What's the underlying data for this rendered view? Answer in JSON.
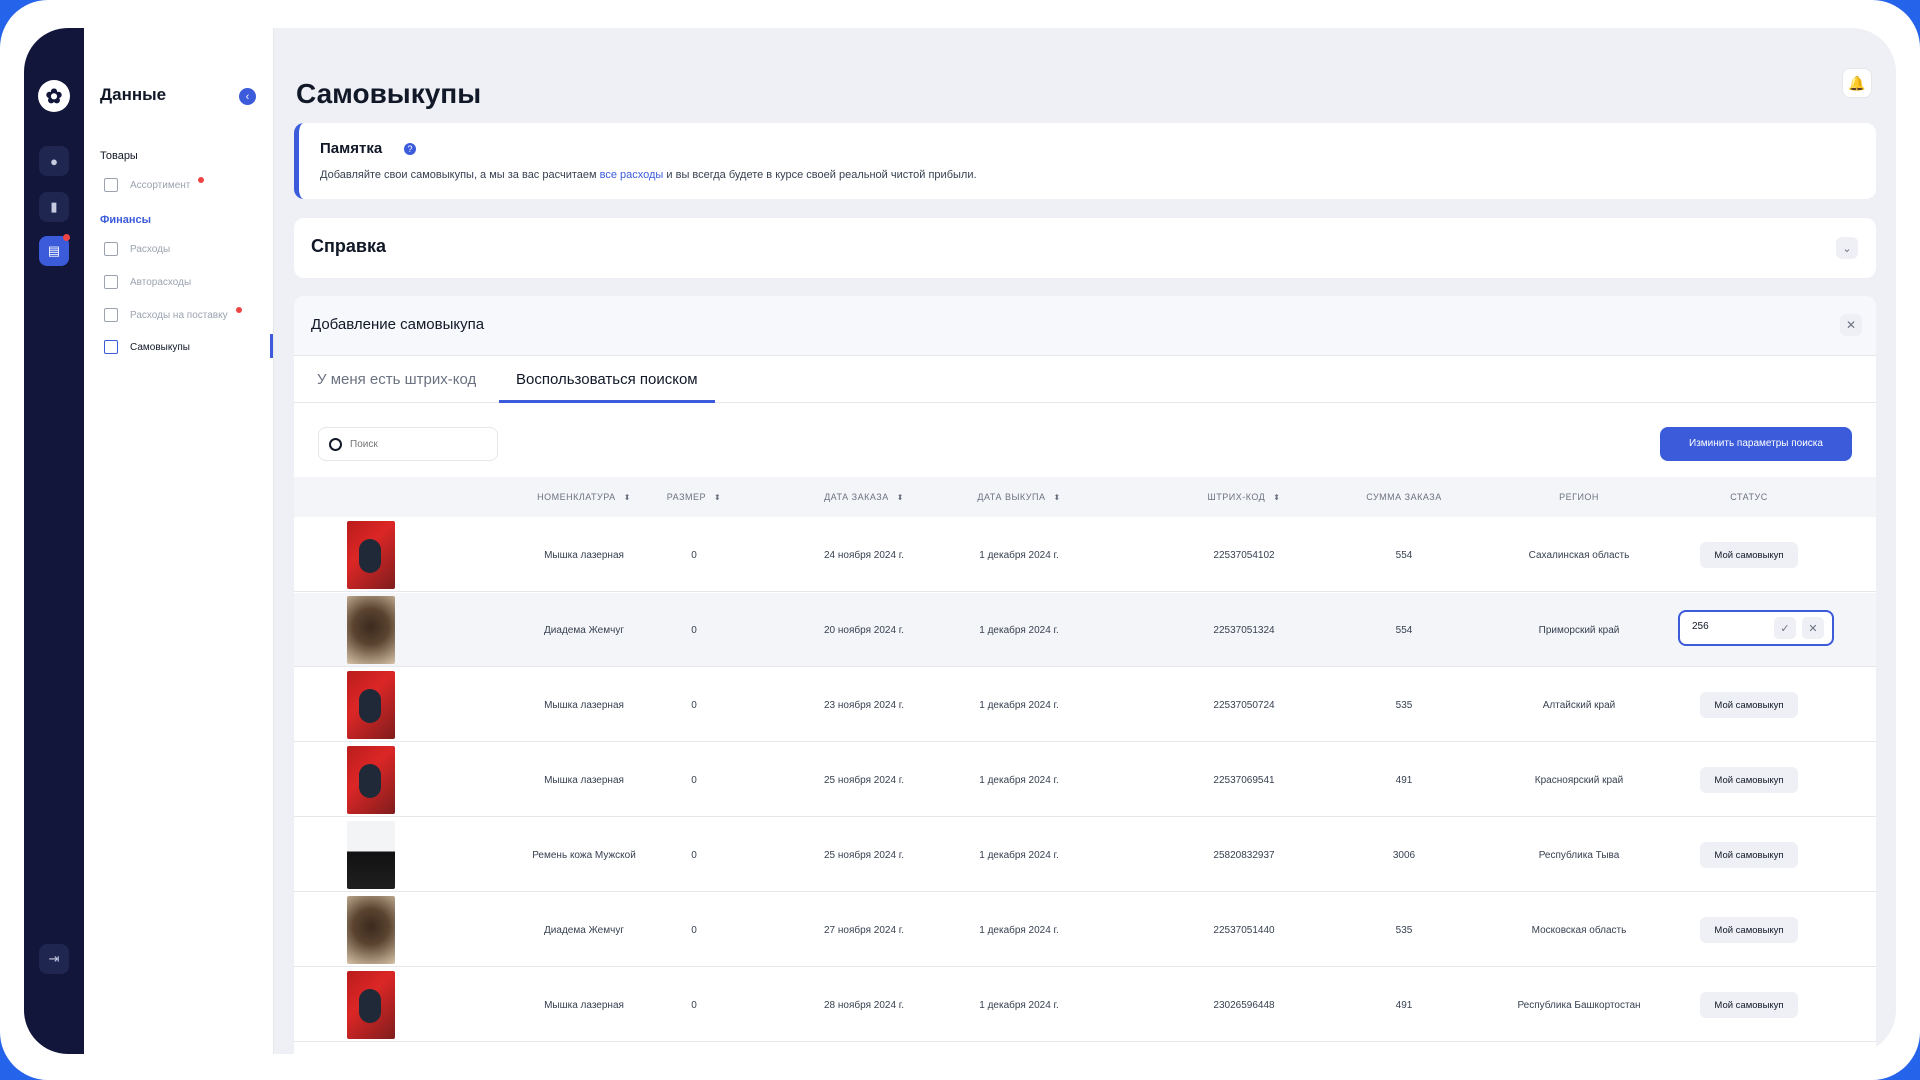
{
  "sidebar": {
    "title": "Данные",
    "groups": [
      {
        "label": "Товары",
        "items": [
          {
            "label": "Ассортимент"
          }
        ]
      },
      {
        "label": "Финансы",
        "items": [
          {
            "label": "Расходы"
          },
          {
            "label": "Авторасходы"
          },
          {
            "label": "Расходы на поставку"
          },
          {
            "label": "Самовыкупы"
          }
        ]
      }
    ]
  },
  "page": {
    "title": "Самовыкупы"
  },
  "memo": {
    "title": "Памятка",
    "text_before": "Добавляйте свои самовыкупы, а мы за вас расчитаем ",
    "link": "все расходы",
    "text_after": " и вы всегда будете в курсе своей реальной чистой прибыли."
  },
  "help": {
    "title": "Справка"
  },
  "panel": {
    "title": "Добавление самовыкупа",
    "tabs": [
      "У меня есть штрих-код",
      "Воспользоваться поиском"
    ],
    "search_placeholder": "Поиск",
    "primary_button": "Изминить параметры поиска"
  },
  "table": {
    "headers": [
      "НОМЕНКЛАТУРА",
      "РАЗМЕР",
      "ДАТА ЗАКАЗА",
      "ДАТА ВЫКУПА",
      "ШТРИХ-КОД",
      "СУММА ЗАКАЗА",
      "РЕГИОН",
      "СТАТУС"
    ],
    "status_label": "Мой самовыкуп",
    "edit_value": "256",
    "rows": [
      {
        "name": "Мышка лазерная",
        "size": "0",
        "order_date": "24 ноября 2024 г.",
        "buy_date": "1 декабря 2024 г.",
        "barcode": "22537054102",
        "sum": "554",
        "region": "Сахалинская область"
      },
      {
        "name": "Диадема Жемчуг",
        "size": "0",
        "order_date": "20 ноября 2024 г.",
        "buy_date": "1 декабря 2024 г.",
        "barcode": "22537051324",
        "sum": "554",
        "region": "Приморский край"
      },
      {
        "name": "Мышка лазерная",
        "size": "0",
        "order_date": "23 ноября 2024 г.",
        "buy_date": "1 декабря 2024 г.",
        "barcode": "22537050724",
        "sum": "535",
        "region": "Алтайский край"
      },
      {
        "name": "Мышка лазерная",
        "size": "0",
        "order_date": "25 ноября 2024 г.",
        "buy_date": "1 декабря 2024 г.",
        "barcode": "22537069541",
        "sum": "491",
        "region": "Красноярский край"
      },
      {
        "name": "Ремень кожа Мужской",
        "size": "0",
        "order_date": "25 ноября 2024 г.",
        "buy_date": "1 декабря 2024 г.",
        "barcode": "25820832937",
        "sum": "3006",
        "region": "Республика Тыва"
      },
      {
        "name": "Диадема Жемчуг",
        "size": "0",
        "order_date": "27 ноября 2024 г.",
        "buy_date": "1 декабря 2024 г.",
        "barcode": "22537051440",
        "sum": "535",
        "region": "Московская область"
      },
      {
        "name": "Мышка лазерная",
        "size": "0",
        "order_date": "28 ноября 2024 г.",
        "buy_date": "1 декабря 2024 г.",
        "barcode": "23026596448",
        "sum": "491",
        "region": "Республика Башкортостан"
      }
    ]
  }
}
